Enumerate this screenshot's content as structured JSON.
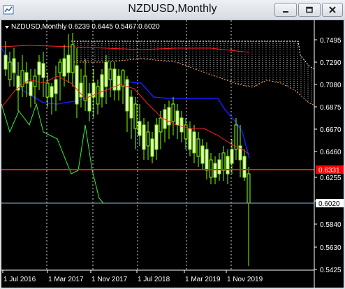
{
  "window": {
    "title": "NZDUSD,Monthly",
    "icon": "chart-window-icon",
    "buttons": [
      {
        "name": "minimize-button",
        "icon": "minimize-icon"
      },
      {
        "name": "restore-button",
        "icon": "restore-icon"
      },
      {
        "name": "close-button",
        "icon": "close-icon"
      }
    ]
  },
  "chart": {
    "symbol_label": "NZDUSD,Monthly",
    "ohlc": "0.6239 0.6445 0.5467 0.6020",
    "price_axis": [
      "0.7495",
      "0.7290",
      "0.7080",
      "0.6875",
      "0.6670",
      "0.6460",
      "0.6255",
      "0.6050",
      "0.5840",
      "0.5630",
      "0.5425"
    ],
    "time_axis": [
      "1 Jul 2016",
      "1 Mar 2017",
      "1 Nov 2017",
      "1 Jul 2018",
      "1 Mar 2019",
      "1 Nov 2019"
    ],
    "red_line_label": "0.6331",
    "current_price_label": "0.6020",
    "colors": {
      "background": "#000000",
      "bull_candle": "#e8f5c8",
      "bear_candle": "#1a1a1a",
      "wick": "#7fff00",
      "red_level": "#ff0000",
      "kijun_blue": "#0000ff",
      "tenkan_red": "#ff0000",
      "chikou_green": "#00ff00",
      "cloud_outline": "#ffffff",
      "cloud_outline_lower": "#ffa060"
    }
  }
}
